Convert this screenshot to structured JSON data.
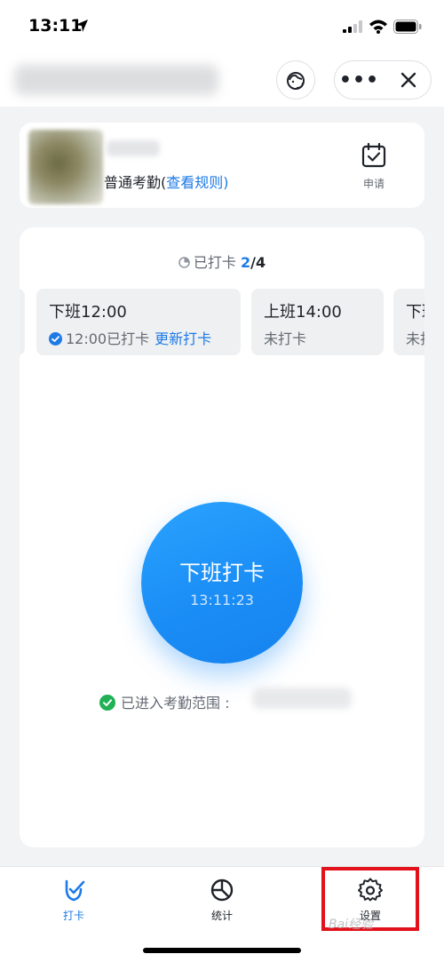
{
  "status_bar": {
    "time": "13:11"
  },
  "header": {
    "help_icon": "headset-icon",
    "more_label": "•••",
    "close_icon": "close-icon"
  },
  "user_card": {
    "rule_prefix": "普通考勤(",
    "rule_link": "查看规则",
    "rule_suffix": ")",
    "apply_label": "申请"
  },
  "progress": {
    "prefix": "已打卡 ",
    "done": "2",
    "total": "/4"
  },
  "shifts": [
    {
      "title": "",
      "status": ""
    },
    {
      "title": "下班12:00",
      "status": "12:00已打卡",
      "action": "更新打卡"
    },
    {
      "title": "上班14:00",
      "status": "未打卡"
    },
    {
      "title": "下班",
      "status": "未打"
    }
  ],
  "punch": {
    "label": "下班打卡",
    "time": "13:11:23"
  },
  "range": {
    "label": "已进入考勤范围 :"
  },
  "tabs": [
    {
      "label": "打卡",
      "icon": "punch-check-icon",
      "active": true
    },
    {
      "label": "统计",
      "icon": "pie-chart-icon",
      "active": false
    },
    {
      "label": "设置",
      "icon": "gear-icon",
      "active": false
    }
  ],
  "watermark": "Bai经验",
  "colors": {
    "accent": "#1e7ae6",
    "button": "#1a8cf5",
    "success": "#21b155",
    "highlight": "#e3111b"
  }
}
